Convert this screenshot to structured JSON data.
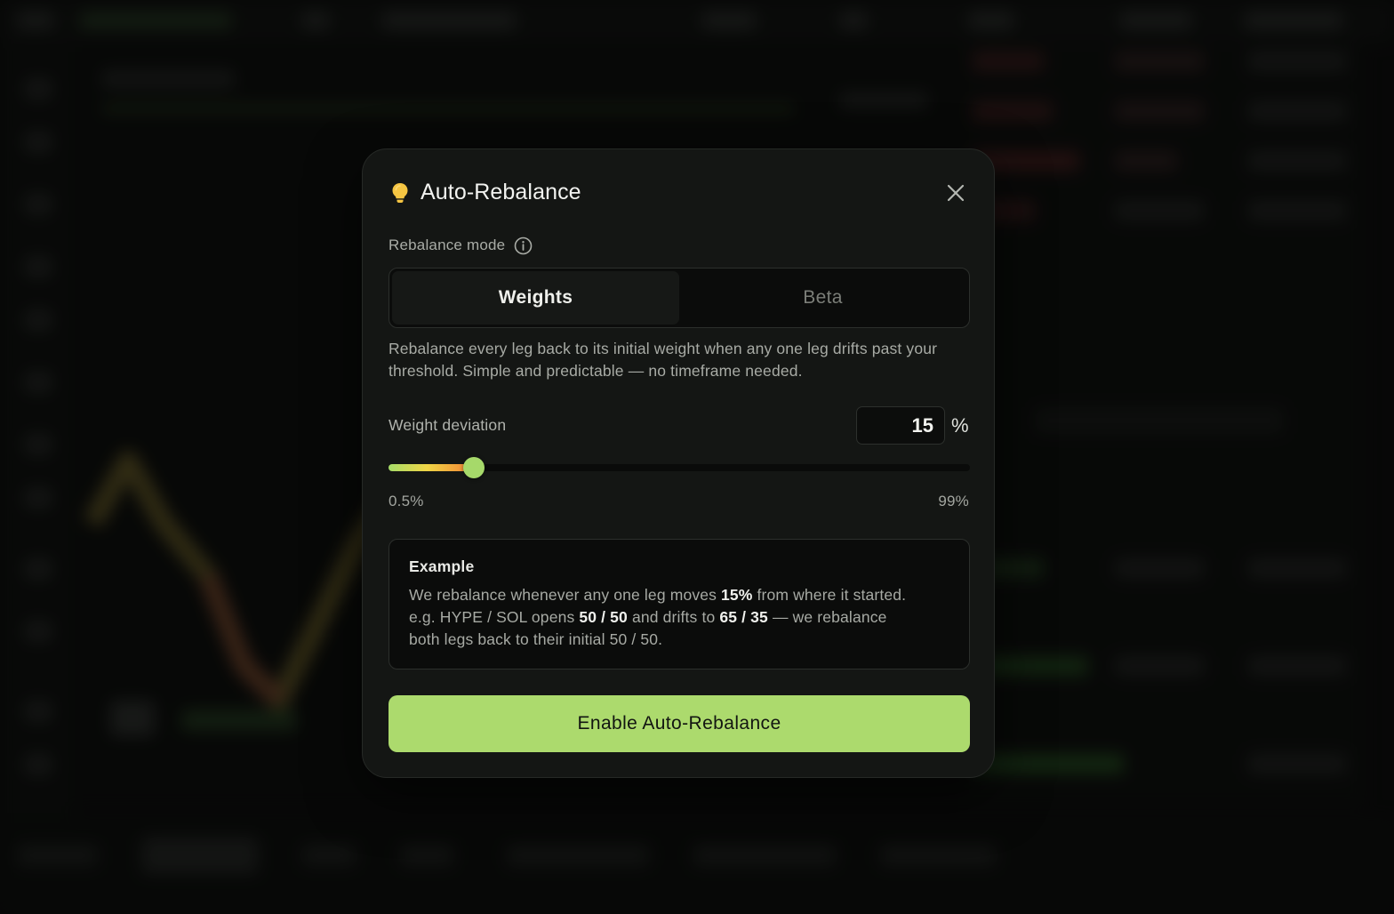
{
  "colors": {
    "accent": "#acda6d",
    "bulb": "#f5c542",
    "modal_bg": "#141614",
    "backdrop": "#0b0c0b"
  },
  "modal": {
    "title": "Auto-Rebalance",
    "title_icon": "lightbulb-icon",
    "close_icon": "close-icon",
    "mode": {
      "label": "Rebalance mode",
      "info_icon": "info-icon",
      "options": [
        "Weights",
        "Beta"
      ],
      "selected": "Weights",
      "description": "Rebalance every leg back to its initial weight when any one leg drifts past your threshold. Simple and predictable — no timeframe needed."
    },
    "deviation": {
      "label": "Weight deviation",
      "value": "15",
      "unit": "%",
      "slider_min_label": "0.5%",
      "slider_max_label": "99%",
      "slider_min": 0.5,
      "slider_max": 99,
      "slider_value": 15
    },
    "example": {
      "title": "Example",
      "line1_a": "We rebalance whenever any one leg moves ",
      "line1_b": "15%",
      "line1_c": " from where it started.",
      "line2_a": "e.g. HYPE / SOL opens ",
      "line2_b": "50 / 50",
      "line2_c": " and drifts to ",
      "line2_d": "65 / 35",
      "line2_e": " — we rebalance",
      "line3": "both legs back to their initial 50 / 50."
    },
    "cta": "Enable Auto-Rebalance"
  }
}
